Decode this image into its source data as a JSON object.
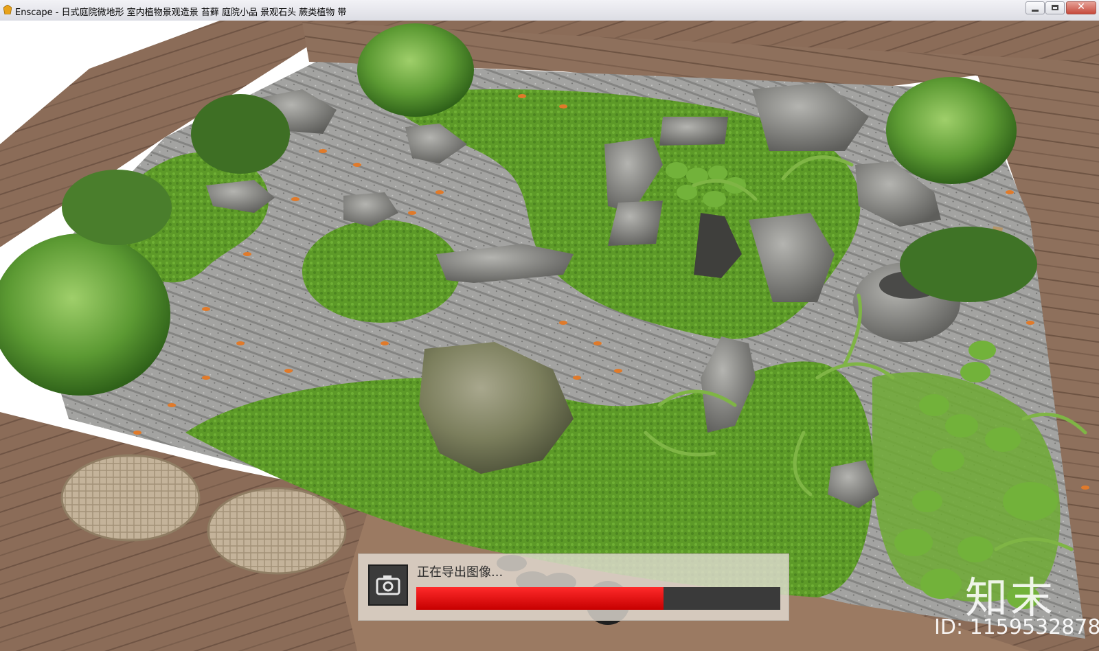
{
  "window": {
    "title": "Enscape - 日式庭院微地形 室内植物景观造景 苔藓 庭院小品 景观石头 蕨类植物 带",
    "controls": {
      "minimize": "minimize",
      "maximize": "maximize",
      "close": "✕"
    }
  },
  "export": {
    "status_text": "正在导出图像...",
    "progress": 0.68,
    "progress_color": "#e00000",
    "icon": "camera-icon"
  },
  "watermark": {
    "logo": "知末",
    "id_text": "ID: 1159532878"
  },
  "colors": {
    "deck": "#8a6b57",
    "moss": "#5f9a2a",
    "gravel": "#9a9a98",
    "rock": "#7d7d7a"
  }
}
